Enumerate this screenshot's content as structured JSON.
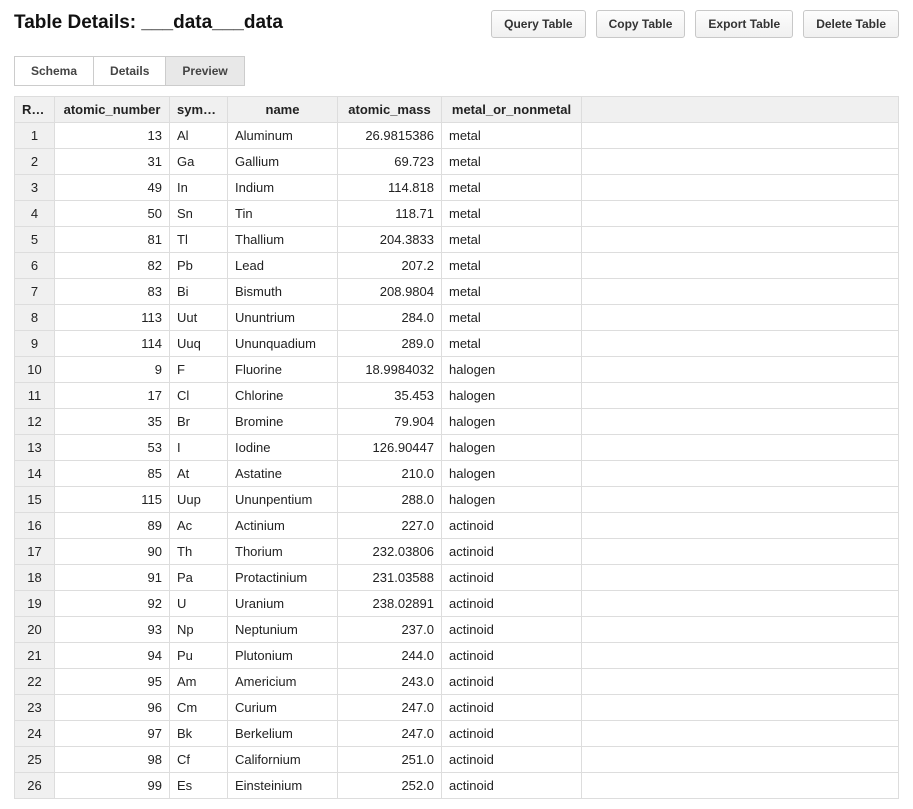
{
  "header": {
    "title": "Table Details: ___data___data",
    "buttons": {
      "query": "Query Table",
      "copy": "Copy Table",
      "export": "Export Table",
      "delete": "Delete Table"
    }
  },
  "tabs": {
    "schema": "Schema",
    "details": "Details",
    "preview": "Preview"
  },
  "table": {
    "headers": {
      "row": "Row",
      "atomic_number": "atomic_number",
      "symbol": "symbol",
      "name": "name",
      "atomic_mass": "atomic_mass",
      "metal_or_nonmetal": "metal_or_nonmetal"
    },
    "rows": [
      {
        "row": "1",
        "atomic_number": "13",
        "symbol": "Al",
        "name": "Aluminum",
        "atomic_mass": "26.9815386",
        "metal_or_nonmetal": "metal"
      },
      {
        "row": "2",
        "atomic_number": "31",
        "symbol": "Ga",
        "name": "Gallium",
        "atomic_mass": "69.723",
        "metal_or_nonmetal": "metal"
      },
      {
        "row": "3",
        "atomic_number": "49",
        "symbol": "In",
        "name": "Indium",
        "atomic_mass": "114.818",
        "metal_or_nonmetal": "metal"
      },
      {
        "row": "4",
        "atomic_number": "50",
        "symbol": "Sn",
        "name": "Tin",
        "atomic_mass": "118.71",
        "metal_or_nonmetal": "metal"
      },
      {
        "row": "5",
        "atomic_number": "81",
        "symbol": "Tl",
        "name": "Thallium",
        "atomic_mass": "204.3833",
        "metal_or_nonmetal": "metal"
      },
      {
        "row": "6",
        "atomic_number": "82",
        "symbol": "Pb",
        "name": "Lead",
        "atomic_mass": "207.2",
        "metal_or_nonmetal": "metal"
      },
      {
        "row": "7",
        "atomic_number": "83",
        "symbol": "Bi",
        "name": "Bismuth",
        "atomic_mass": "208.9804",
        "metal_or_nonmetal": "metal"
      },
      {
        "row": "8",
        "atomic_number": "113",
        "symbol": "Uut",
        "name": "Ununtrium",
        "atomic_mass": "284.0",
        "metal_or_nonmetal": "metal"
      },
      {
        "row": "9",
        "atomic_number": "114",
        "symbol": "Uuq",
        "name": "Ununquadium",
        "atomic_mass": "289.0",
        "metal_or_nonmetal": "metal"
      },
      {
        "row": "10",
        "atomic_number": "9",
        "symbol": "F",
        "name": "Fluorine",
        "atomic_mass": "18.9984032",
        "metal_or_nonmetal": "halogen"
      },
      {
        "row": "11",
        "atomic_number": "17",
        "symbol": "Cl",
        "name": "Chlorine",
        "atomic_mass": "35.453",
        "metal_or_nonmetal": "halogen"
      },
      {
        "row": "12",
        "atomic_number": "35",
        "symbol": "Br",
        "name": "Bromine",
        "atomic_mass": "79.904",
        "metal_or_nonmetal": "halogen"
      },
      {
        "row": "13",
        "atomic_number": "53",
        "symbol": "I",
        "name": "Iodine",
        "atomic_mass": "126.90447",
        "metal_or_nonmetal": "halogen"
      },
      {
        "row": "14",
        "atomic_number": "85",
        "symbol": "At",
        "name": "Astatine",
        "atomic_mass": "210.0",
        "metal_or_nonmetal": "halogen"
      },
      {
        "row": "15",
        "atomic_number": "115",
        "symbol": "Uup",
        "name": "Ununpentium",
        "atomic_mass": "288.0",
        "metal_or_nonmetal": "halogen"
      },
      {
        "row": "16",
        "atomic_number": "89",
        "symbol": "Ac",
        "name": "Actinium",
        "atomic_mass": "227.0",
        "metal_or_nonmetal": "actinoid"
      },
      {
        "row": "17",
        "atomic_number": "90",
        "symbol": "Th",
        "name": "Thorium",
        "atomic_mass": "232.03806",
        "metal_or_nonmetal": "actinoid"
      },
      {
        "row": "18",
        "atomic_number": "91",
        "symbol": "Pa",
        "name": "Protactinium",
        "atomic_mass": "231.03588",
        "metal_or_nonmetal": "actinoid"
      },
      {
        "row": "19",
        "atomic_number": "92",
        "symbol": "U",
        "name": "Uranium",
        "atomic_mass": "238.02891",
        "metal_or_nonmetal": "actinoid"
      },
      {
        "row": "20",
        "atomic_number": "93",
        "symbol": "Np",
        "name": "Neptunium",
        "atomic_mass": "237.0",
        "metal_or_nonmetal": "actinoid"
      },
      {
        "row": "21",
        "atomic_number": "94",
        "symbol": "Pu",
        "name": "Plutonium",
        "atomic_mass": "244.0",
        "metal_or_nonmetal": "actinoid"
      },
      {
        "row": "22",
        "atomic_number": "95",
        "symbol": "Am",
        "name": "Americium",
        "atomic_mass": "243.0",
        "metal_or_nonmetal": "actinoid"
      },
      {
        "row": "23",
        "atomic_number": "96",
        "symbol": "Cm",
        "name": "Curium",
        "atomic_mass": "247.0",
        "metal_or_nonmetal": "actinoid"
      },
      {
        "row": "24",
        "atomic_number": "97",
        "symbol": "Bk",
        "name": "Berkelium",
        "atomic_mass": "247.0",
        "metal_or_nonmetal": "actinoid"
      },
      {
        "row": "25",
        "atomic_number": "98",
        "symbol": "Cf",
        "name": "Californium",
        "atomic_mass": "251.0",
        "metal_or_nonmetal": "actinoid"
      },
      {
        "row": "26",
        "atomic_number": "99",
        "symbol": "Es",
        "name": "Einsteinium",
        "atomic_mass": "252.0",
        "metal_or_nonmetal": "actinoid"
      }
    ]
  }
}
